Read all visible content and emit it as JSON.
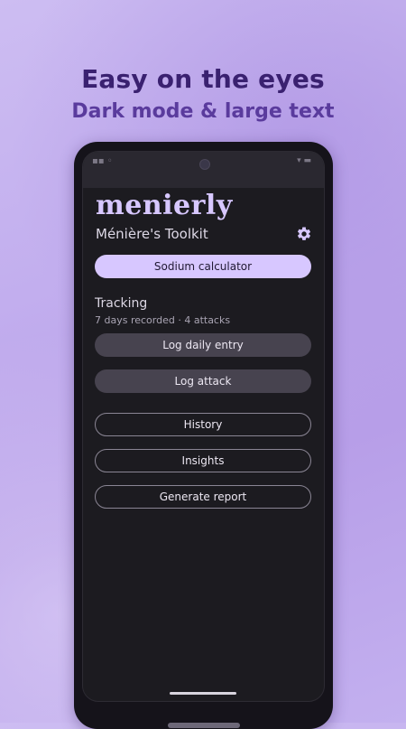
{
  "promo": {
    "headline": "Easy on the eyes",
    "subheadline": "Dark mode & large text"
  },
  "app": {
    "logo_text": "menierly",
    "title": "Ménière's Toolkit",
    "settings_icon": "gear-icon"
  },
  "buttons": {
    "sodium": "Sodium calculator",
    "log_daily": "Log daily entry",
    "log_attack": "Log attack",
    "history": "History",
    "insights": "Insights",
    "report": "Generate report"
  },
  "tracking": {
    "title": "Tracking",
    "summary": "7 days recorded · 4 attacks"
  },
  "colors": {
    "accent": "#d7c7ff",
    "background": "#1c1b20",
    "tonal_button": "#47434f"
  }
}
